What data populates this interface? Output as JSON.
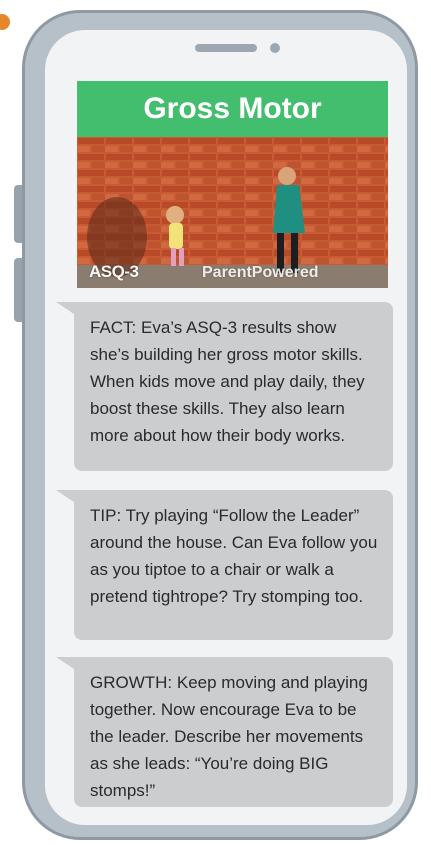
{
  "card": {
    "title": "Gross Motor",
    "logo_asq": "ASQ-3",
    "logo_partner": "ParentPowered",
    "title_color": "#43bd6e"
  },
  "messages": [
    {
      "type": "fact",
      "text": "FACT: Eva’s ASQ-3 results show she’s building her gross motor skills. When kids move and play daily, they boost these skills. They also learn more about how their body works."
    },
    {
      "type": "tip",
      "text": "TIP: Try playing “Follow the Leader” around the house. Can Eva follow you as you tiptoe to a chair or walk a pretend tightrope? Try stomping too."
    },
    {
      "type": "growth",
      "text": "GROWTH: Keep moving and playing together. Now encourage Eva to be the leader. Describe her movements as she leads: “You’re doing BIG stomps!”"
    }
  ],
  "colors": {
    "bubble": "#cccdcf",
    "phone_frame": "#b6c0c9",
    "screen": "#f2f3f5"
  },
  "icons": [
    "speaker-icon",
    "camera-icon",
    "side-buttons"
  ]
}
